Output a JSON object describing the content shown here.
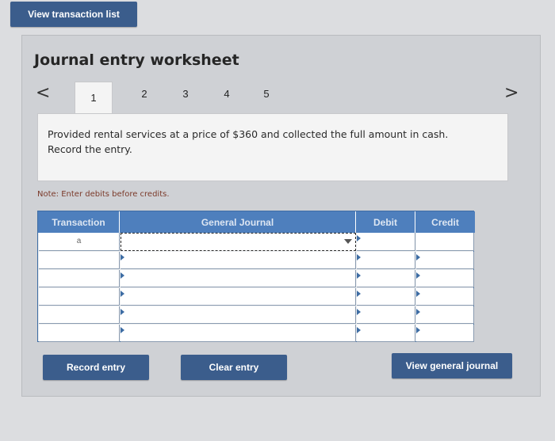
{
  "header": {
    "view_list_label": "View transaction list"
  },
  "worksheet": {
    "title": "Journal entry worksheet",
    "prev": "<",
    "next": ">",
    "tabs": [
      {
        "label": "1",
        "active": true
      },
      {
        "label": "2",
        "active": false
      },
      {
        "label": "3",
        "active": false
      },
      {
        "label": "4",
        "active": false
      },
      {
        "label": "5",
        "active": false
      }
    ],
    "prompt": "Provided rental services at a price of $360 and collected the full amount in cash. Record the entry.",
    "note": "Note: Enter debits before credits."
  },
  "journal": {
    "columns": [
      "Transaction",
      "General Journal",
      "Debit",
      "Credit"
    ],
    "rows": [
      {
        "transaction": "a",
        "account": "",
        "debit": "",
        "credit": ""
      },
      {
        "transaction": "",
        "account": "",
        "debit": "",
        "credit": ""
      },
      {
        "transaction": "",
        "account": "",
        "debit": "",
        "credit": ""
      },
      {
        "transaction": "",
        "account": "",
        "debit": "",
        "credit": ""
      },
      {
        "transaction": "",
        "account": "",
        "debit": "",
        "credit": ""
      },
      {
        "transaction": "",
        "account": "",
        "debit": "",
        "credit": ""
      }
    ]
  },
  "actions": {
    "record": "Record entry",
    "clear": "Clear entry",
    "view_journal": "View general journal"
  },
  "colors": {
    "accent": "#3b5d8c",
    "table_header": "#4e7fbd"
  }
}
